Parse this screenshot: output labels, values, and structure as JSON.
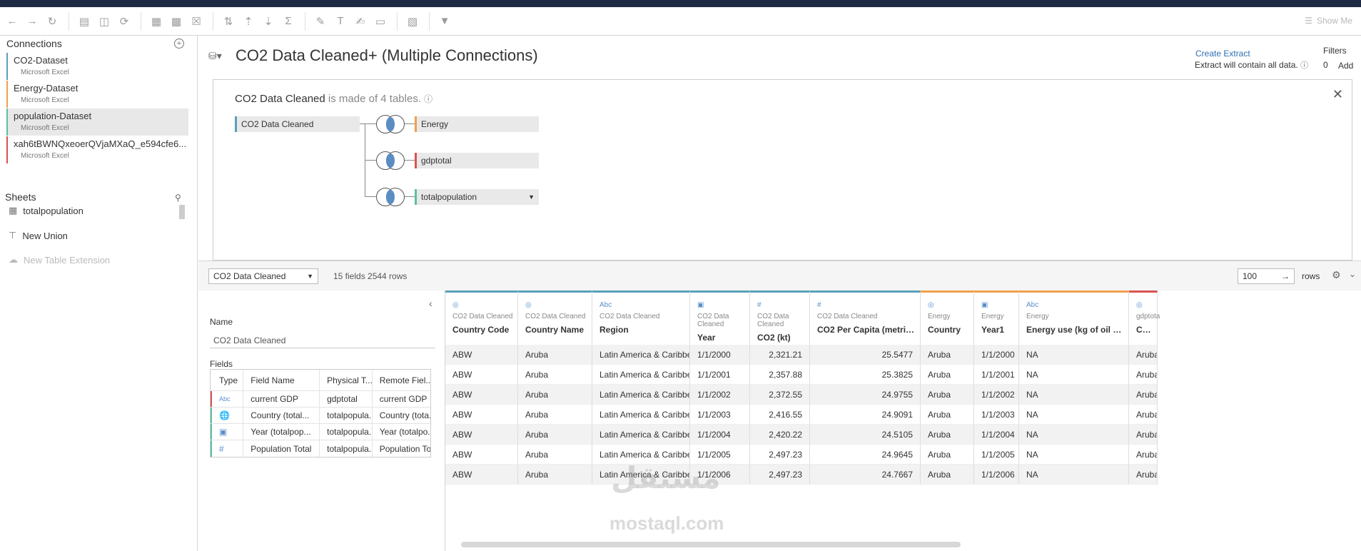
{
  "toolbar": {
    "show_me": "Show Me"
  },
  "connections": {
    "title": "Connections",
    "items": [
      {
        "name": "CO2-Dataset",
        "type": "Microsoft Excel",
        "color": "#5a9fb9"
      },
      {
        "name": "Energy-Dataset",
        "type": "Microsoft Excel",
        "color": "#f0a04b"
      },
      {
        "name": "population-Dataset",
        "type": "Microsoft Excel",
        "color": "#5fbf9f"
      },
      {
        "name": "xah6tBWNQxeoerQVjaMXaQ_e594cfe6...",
        "type": "Microsoft Excel",
        "color": "#d9534f"
      }
    ]
  },
  "sheets": {
    "title": "Sheets",
    "items": [
      "totalpopulation"
    ],
    "new_union": "New Union",
    "new_table_extension": "New Table Extension"
  },
  "datasource": {
    "title": "CO2 Data Cleaned+ (Multiple Connections)",
    "create_extract": "Create Extract",
    "extract_note": "Extract will contain all data.",
    "filters_label": "Filters",
    "filters_count": "0",
    "filters_add": "Add"
  },
  "canvas": {
    "table_name": "CO2 Data Cleaned",
    "made_of": "is made of 4 tables.",
    "root": "CO2 Data Cleaned",
    "joins": [
      {
        "name": "Energy",
        "color": "#f0a04b"
      },
      {
        "name": "gdptotal",
        "color": "#d9534f"
      },
      {
        "name": "totalpopulation",
        "color": "#5fbf9f"
      }
    ]
  },
  "bottom": {
    "table_select": "CO2 Data Cleaned",
    "fields_info": "15 fields 2544 rows",
    "rows_value": "100",
    "rows_label": "rows"
  },
  "meta": {
    "name_label": "Name",
    "name_value": "CO2 Data Cleaned",
    "fields_label": "Fields",
    "headers": [
      "Type",
      "Field Name",
      "Physical T...",
      "Remote Fiel..."
    ],
    "rows": [
      {
        "type": "Abc",
        "field": "current GDP",
        "physical": "gdptotal",
        "remote": "current GDP",
        "color": "#d9534f"
      },
      {
        "type": "globe",
        "field": "Country (total...",
        "physical": "totalpopula...",
        "remote": "Country (tota...",
        "color": "#5fbf9f"
      },
      {
        "type": "calendar",
        "field": "Year (totalpop...",
        "physical": "totalpopula...",
        "remote": "Year (totalpo...",
        "color": "#5fbf9f"
      },
      {
        "type": "#",
        "field": "Population Total",
        "physical": "totalpopula...",
        "remote": "Population To...",
        "color": "#5fbf9f"
      }
    ]
  },
  "grid": {
    "columns": [
      {
        "icon": "globe",
        "source": "CO2 Data Cleaned",
        "name": "Country Code",
        "align": "l"
      },
      {
        "icon": "globe",
        "source": "CO2 Data Cleaned",
        "name": "Country Name",
        "align": "l"
      },
      {
        "icon": "Abc",
        "source": "CO2 Data Cleaned",
        "name": "Region",
        "align": "l"
      },
      {
        "icon": "calendar",
        "source": "CO2 Data Cleaned",
        "name": "Year",
        "align": "l"
      },
      {
        "icon": "#",
        "source": "CO2 Data Cleaned",
        "name": "CO2 (kt)",
        "align": "r"
      },
      {
        "icon": "#",
        "source": "CO2 Data Cleaned",
        "name": "CO2 Per Capita (metric ...",
        "align": "r"
      },
      {
        "icon": "globe",
        "source": "Energy",
        "name": "Country",
        "align": "l"
      },
      {
        "icon": "calendar",
        "source": "Energy",
        "name": "Year1",
        "align": "l"
      },
      {
        "icon": "Abc",
        "source": "Energy",
        "name": "Energy use (kg of oil eq...",
        "align": "l"
      },
      {
        "icon": "globe",
        "source": "gdptota",
        "name": "Count",
        "align": "l"
      }
    ],
    "rows": [
      [
        "ABW",
        "Aruba",
        "Latin America & Caribbean",
        "1/1/2000",
        "2,321.21",
        "25.5477",
        "Aruba",
        "1/1/2000",
        "NA",
        "Aruba"
      ],
      [
        "ABW",
        "Aruba",
        "Latin America & Caribbean",
        "1/1/2001",
        "2,357.88",
        "25.3825",
        "Aruba",
        "1/1/2001",
        "NA",
        "Aruba"
      ],
      [
        "ABW",
        "Aruba",
        "Latin America & Caribbean",
        "1/1/2002",
        "2,372.55",
        "24.9755",
        "Aruba",
        "1/1/2002",
        "NA",
        "Aruba"
      ],
      [
        "ABW",
        "Aruba",
        "Latin America & Caribbean",
        "1/1/2003",
        "2,416.55",
        "24.9091",
        "Aruba",
        "1/1/2003",
        "NA",
        "Aruba"
      ],
      [
        "ABW",
        "Aruba",
        "Latin America & Caribbean",
        "1/1/2004",
        "2,420.22",
        "24.5105",
        "Aruba",
        "1/1/2004",
        "NA",
        "Aruba"
      ],
      [
        "ABW",
        "Aruba",
        "Latin America & Caribbean",
        "1/1/2005",
        "2,497.23",
        "24.9645",
        "Aruba",
        "1/1/2005",
        "NA",
        "Aruba"
      ],
      [
        "ABW",
        "Aruba",
        "Latin America & Caribbean",
        "1/1/2006",
        "2,497.23",
        "24.7667",
        "Aruba",
        "1/1/2006",
        "NA",
        "Aruba"
      ]
    ]
  },
  "watermark": {
    "arabic": "مستقل",
    "latin": "mostaql.com"
  }
}
